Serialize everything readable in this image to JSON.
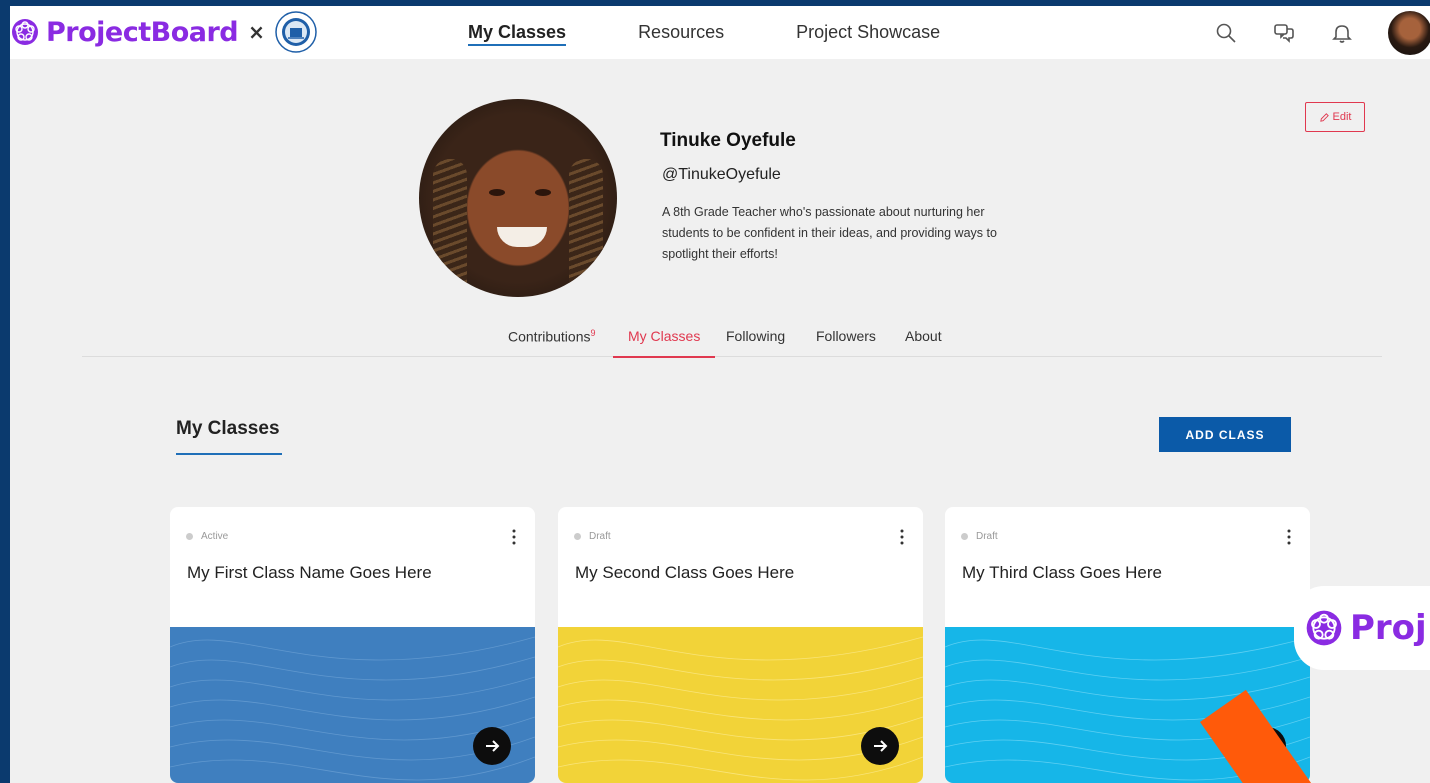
{
  "brand": {
    "name": "ProjectBoard",
    "separator": "×",
    "partner_seal": "The Ohio Academy of Science seal"
  },
  "nav": {
    "links": [
      {
        "label": "My Classes",
        "active": true
      },
      {
        "label": "Resources",
        "active": false
      },
      {
        "label": "Project Showcase",
        "active": false
      }
    ],
    "icons": [
      "search-icon",
      "chat-icon",
      "bell-icon"
    ]
  },
  "profile": {
    "name": "Tinuke Oyefule",
    "handle": "@TinukeOyefule",
    "bio": "A 8th Grade Teacher who's passionate about nurturing her students to be confident in their ideas, and providing ways to spotlight their efforts!",
    "edit_label": "Edit"
  },
  "tabs": [
    {
      "label": "Contributions",
      "count": "9"
    },
    {
      "label": "My Classes",
      "active": true
    },
    {
      "label": "Following"
    },
    {
      "label": "Followers"
    },
    {
      "label": "About"
    }
  ],
  "section": {
    "title": "My Classes",
    "add_button": "ADD CLASS"
  },
  "cards": [
    {
      "status": "Active",
      "title": "My First Class Name Goes Here",
      "cover_color": "#3f7fbf"
    },
    {
      "status": "Draft",
      "title": "My Second Class Goes Here",
      "cover_color": "#f2d338"
    },
    {
      "status": "Draft",
      "title": "My Third Class Goes Here",
      "cover_color": "#16b6e8"
    }
  ],
  "promo": {
    "text": "Proj"
  },
  "colors": {
    "brand_purple": "#8a2be2",
    "accent_red": "#e0384f",
    "nav_blue": "#1f6fb8",
    "button_blue": "#0b5aa8",
    "orange": "#ff5a0a"
  }
}
